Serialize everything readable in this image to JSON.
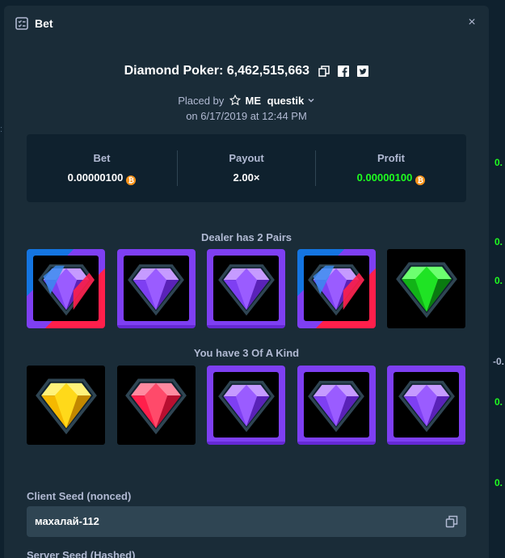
{
  "modal": {
    "title": "Bet",
    "close_label": "×"
  },
  "bet": {
    "game_title": "Diamond Poker: 6,462,515,663",
    "placed_by_label": "Placed by",
    "vip_badge": "ME",
    "username": "questik",
    "date_line": "on 6/17/2019 at 12:44 PM"
  },
  "stats": {
    "bet_label": "Bet",
    "bet_value": "0.00000100",
    "payout_label": "Payout",
    "payout_value": "2.00×",
    "profit_label": "Profit",
    "profit_value": "0.00000100",
    "currency_icon": "bitcoin-icon"
  },
  "dealer": {
    "label": "Dealer has 2 Pairs",
    "gems": [
      "multi",
      "purple",
      "purple",
      "multi",
      "green"
    ]
  },
  "player": {
    "label": "You have 3 Of A Kind",
    "gems": [
      "yellow",
      "red",
      "purple",
      "purple",
      "purple"
    ]
  },
  "seeds": {
    "client_label": "Client Seed (nonced)",
    "client_value": "махалай-112",
    "server_label": "Server Seed (Hashed)"
  },
  "colors": {
    "profit_green": "#1fff20",
    "accent_purple": "#7e3ff2",
    "bitcoin_orange": "#f7931a"
  }
}
